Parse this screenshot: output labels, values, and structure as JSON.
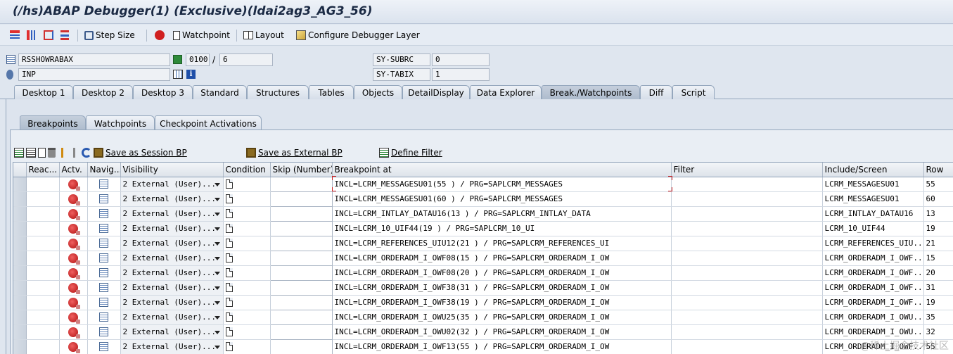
{
  "window": {
    "title": "(/hs)ABAP Debugger(1)  (Exclusive)(ldai2ag3_AG3_56)"
  },
  "toolbar": {
    "step_size": "Step Size",
    "watchpoint": "Watchpoint",
    "layout": "Layout",
    "configure": "Configure Debugger Layer"
  },
  "header": {
    "program": "RSSHOWRABAX",
    "event": "INP",
    "line": "0100",
    "line_sep": "/",
    "line_total": "6",
    "subrc_label": "SY-SUBRC",
    "subrc_value": "0",
    "tabix_label": "SY-TABIX",
    "tabix_value": "1"
  },
  "main_tabs": [
    "Desktop 1",
    "Desktop 2",
    "Desktop 3",
    "Standard",
    "Structures",
    "Tables",
    "Objects",
    "DetailDisplay",
    "Data Explorer",
    "Break./Watchpoints",
    "Diff",
    "Script"
  ],
  "main_tab_active": "Break./Watchpoints",
  "sub_tabs": [
    "Breakpoints",
    "Watchpoints",
    "Checkpoint Activations"
  ],
  "sub_tab_active": "Breakpoints",
  "bp_toolbar": {
    "save_session": "Save as Session BP",
    "save_external": "Save as External BP",
    "define_filter": "Define Filter"
  },
  "grid": {
    "columns": [
      "",
      "Reac...",
      "Actv.",
      "Navig...",
      "Visibility",
      "Condition",
      "Skip (Number)",
      "Breakpoint at",
      "Filter",
      "Include/Screen",
      "Row"
    ],
    "rows": [
      {
        "visibility": "2 External (User)...",
        "bp": "INCL=LCRM_MESSAGESU01(55 ) / PRG=SAPLCRM_MESSAGES",
        "include": "LCRM_MESSAGESU01",
        "row": "55"
      },
      {
        "visibility": "2 External (User)...",
        "bp": "INCL=LCRM_MESSAGESU01(60 ) / PRG=SAPLCRM_MESSAGES",
        "include": "LCRM_MESSAGESU01",
        "row": "60"
      },
      {
        "visibility": "2 External (User)...",
        "bp": "INCL=LCRM_INTLAY_DATAU16(13 ) / PRG=SAPLCRM_INTLAY_DATA",
        "include": "LCRM_INTLAY_DATAU16",
        "row": "13"
      },
      {
        "visibility": "2 External (User)...",
        "bp": "INCL=LCRM_10_UIF44(19 ) / PRG=SAPLCRM_10_UI",
        "include": "LCRM_10_UIF44",
        "row": "19"
      },
      {
        "visibility": "2 External (User)...",
        "bp": "INCL=LCRM_REFERENCES_UIU12(21 ) / PRG=SAPLCRM_REFERENCES_UI",
        "include": "LCRM_REFERENCES_UIU...",
        "row": "21"
      },
      {
        "visibility": "2 External (User)...",
        "bp": "INCL=LCRM_ORDERADM_I_OWF08(15 ) / PRG=SAPLCRM_ORDERADM_I_OW",
        "include": "LCRM_ORDERADM_I_OWF...",
        "row": "15"
      },
      {
        "visibility": "2 External (User)...",
        "bp": "INCL=LCRM_ORDERADM_I_OWF08(20 ) / PRG=SAPLCRM_ORDERADM_I_OW",
        "include": "LCRM_ORDERADM_I_OWF...",
        "row": "20"
      },
      {
        "visibility": "2 External (User)...",
        "bp": "INCL=LCRM_ORDERADM_I_OWF38(31 ) / PRG=SAPLCRM_ORDERADM_I_OW",
        "include": "LCRM_ORDERADM_I_OWF...",
        "row": "31"
      },
      {
        "visibility": "2 External (User)...",
        "bp": "INCL=LCRM_ORDERADM_I_OWF38(19 ) / PRG=SAPLCRM_ORDERADM_I_OW",
        "include": "LCRM_ORDERADM_I_OWF...",
        "row": "19"
      },
      {
        "visibility": "2 External (User)...",
        "bp": "INCL=LCRM_ORDERADM_I_OWU25(35 ) / PRG=SAPLCRM_ORDERADM_I_OW",
        "include": "LCRM_ORDERADM_I_OWU...",
        "row": "35"
      },
      {
        "visibility": "2 External (User)...",
        "bp": "INCL=LCRM_ORDERADM_I_OWU02(32 ) / PRG=SAPLCRM_ORDERADM_I_OW",
        "include": "LCRM_ORDERADM_I_OWU...",
        "row": "32"
      },
      {
        "visibility": "2 External (User)...",
        "bp": "INCL=LCRM_ORDERADM_I_OWF13(55 ) / PRG=SAPLCRM_ORDERADM_I_OW",
        "include": "LCRM_ORDERADM_I_OWF...",
        "row": "55"
      }
    ]
  },
  "watermark": "@稀土掘金技术社区"
}
